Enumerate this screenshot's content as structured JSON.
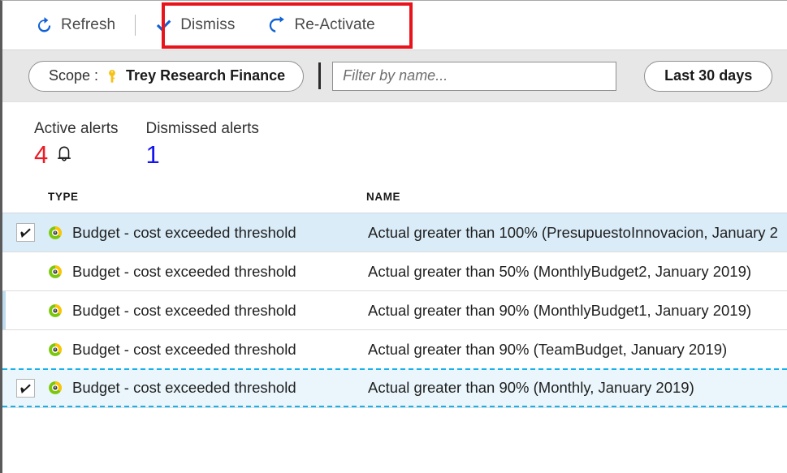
{
  "toolbar": {
    "refresh_label": "Refresh",
    "dismiss_label": "Dismiss",
    "reactivate_label": "Re-Activate",
    "refresh_icon": "refresh-circular-arrow-icon",
    "dismiss_icon": "checkmark-icon",
    "reactivate_icon": "undo-arrow-icon",
    "highlight_color": "#e8141c",
    "icon_color": "#1061d6"
  },
  "filterbar": {
    "scope_prefix": "Scope :",
    "scope_icon": "key-icon",
    "scope_value": "Trey Research Finance",
    "filter_placeholder": "Filter by name...",
    "filter_value": "",
    "date_range_label": "Last 30 days"
  },
  "summary": [
    {
      "title": "Active alerts",
      "count": "4",
      "color": "#ec1c24",
      "icon": "bell-icon"
    },
    {
      "title": "Dismissed alerts",
      "count": "1",
      "color": "#1414f0",
      "icon": ""
    }
  ],
  "table": {
    "columns": {
      "type": "TYPE",
      "name": "NAME"
    },
    "rows": [
      {
        "checked": true,
        "state": "selected",
        "icon": "budget-donut-icon",
        "type": "Budget - cost exceeded threshold",
        "name": "Actual greater than 100% (PresupuestoInnovacion, January 2"
      },
      {
        "checked": false,
        "state": "normal",
        "icon": "budget-donut-icon",
        "type": "Budget - cost exceeded threshold",
        "name": "Actual greater than 50% (MonthlyBudget2, January 2019)"
      },
      {
        "checked": false,
        "state": "accent",
        "icon": "budget-donut-icon",
        "type": "Budget - cost exceeded threshold",
        "name": "Actual greater than 90% (MonthlyBudget1, January 2019)"
      },
      {
        "checked": false,
        "state": "normal",
        "icon": "budget-donut-icon",
        "type": "Budget - cost exceeded threshold",
        "name": "Actual greater than 90% (TeamBudget, January 2019)"
      },
      {
        "checked": true,
        "state": "focused",
        "icon": "budget-donut-icon",
        "type": "Budget - cost exceeded threshold",
        "name": "Actual greater than 90% (Monthly, January 2019)"
      }
    ]
  }
}
